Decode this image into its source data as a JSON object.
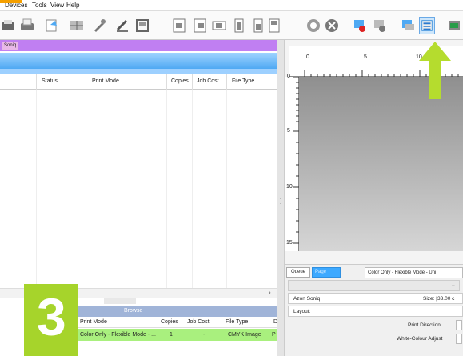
{
  "menu": [
    "Devices",
    "Tools",
    "View",
    "Help"
  ],
  "toolbar": {
    "icons": [
      "printer-icon",
      "send-to-printer-icon",
      "reprint-icon",
      "layout-icon",
      "eye-dropper-icon",
      "rotate-icon",
      "frame-icon",
      "nudge-left-icon",
      "center-icon",
      "nudge-right-icon",
      "fit-icon",
      "align-icon",
      "page-icon",
      "zoom-icon",
      "delete-icon",
      "gear-blue-icon",
      "gear-red-icon",
      "copy-icon",
      "selected-view-icon",
      "more-icon"
    ]
  },
  "printer_tab": "Soniq",
  "queue_table": {
    "columns": [
      "Status",
      "Print Mode",
      "Copies",
      "Job Cost",
      "File Type"
    ]
  },
  "browse": {
    "title": "Browse",
    "columns": [
      "Print Mode",
      "Copies",
      "Job Cost",
      "File Type",
      "D"
    ],
    "row": [
      "Color Only - Flexible Mode - ...",
      "1",
      "-",
      "CMYK Image",
      "P"
    ]
  },
  "step_number": "3",
  "ruler": {
    "top_labels": [
      "0",
      "5",
      "10"
    ],
    "left_labels": [
      "0",
      "5",
      "10",
      "15"
    ]
  },
  "panel": {
    "tab_queue": "Queue",
    "tab_page": "Page",
    "mode_value": "Color Only - Flexible Mode - Uni",
    "printer_name": "Azon Soniq",
    "size_label": "Size: [33.00 c",
    "layout_label": "Layout:",
    "print_direction": "Print Direction",
    "white_colour_adjust": "White-Colour Adjust"
  },
  "colors": {
    "accent_purple": "#c07ff2",
    "accent_blue": "#4fa9f3",
    "highlight_green": "#a9f07e",
    "step_green": "#a6d42b",
    "arrow_green": "#b5dc2e"
  }
}
